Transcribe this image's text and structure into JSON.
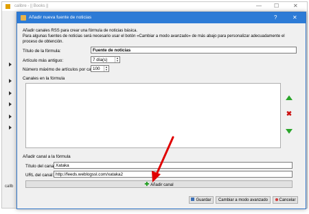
{
  "background": {
    "window_title": "calibre - || Books ||",
    "sidebar_label": "callb"
  },
  "dialog": {
    "title": "Añadir nueva fuente de noticias",
    "description": "Añadir canales RSS para crear una fórmula de noticias básica.\nPara algunas fuentes de noticias será necesario usar el botón «Cambiar a modo avanzado» de más abajo para personalizar adecuadamente el proceso de obtención.",
    "help_button": "?",
    "close_button": "✕"
  },
  "form": {
    "title_label": "Título de la fórmula:",
    "title_value": "Fuente de noticias",
    "oldest_label": "Artículo más antiguo:",
    "oldest_value": "7 día(s)",
    "max_label": "Número máximo de artículos por canal:",
    "max_value": "100"
  },
  "feeds": {
    "header": "Canales en la fórmula",
    "items": []
  },
  "add_feed": {
    "header": "Añadir canal a la fórmula",
    "feed_title_label": "Título del canal:",
    "feed_title_value": "Xataka",
    "url_label": "URL del canal:",
    "url_value": "http://feeds.weblogssl.com/xataka2",
    "add_button_label": "Añadir canal"
  },
  "footer": {
    "save_label": "Guardar",
    "advanced_label": "Cambiar a modo avanzado",
    "cancel_label": "Cancelar"
  },
  "colors": {
    "title_bar": "#2d7bd6",
    "arrow": "#e00000",
    "add_icon": "#1a9d1a",
    "remove_icon": "#cc1111"
  }
}
